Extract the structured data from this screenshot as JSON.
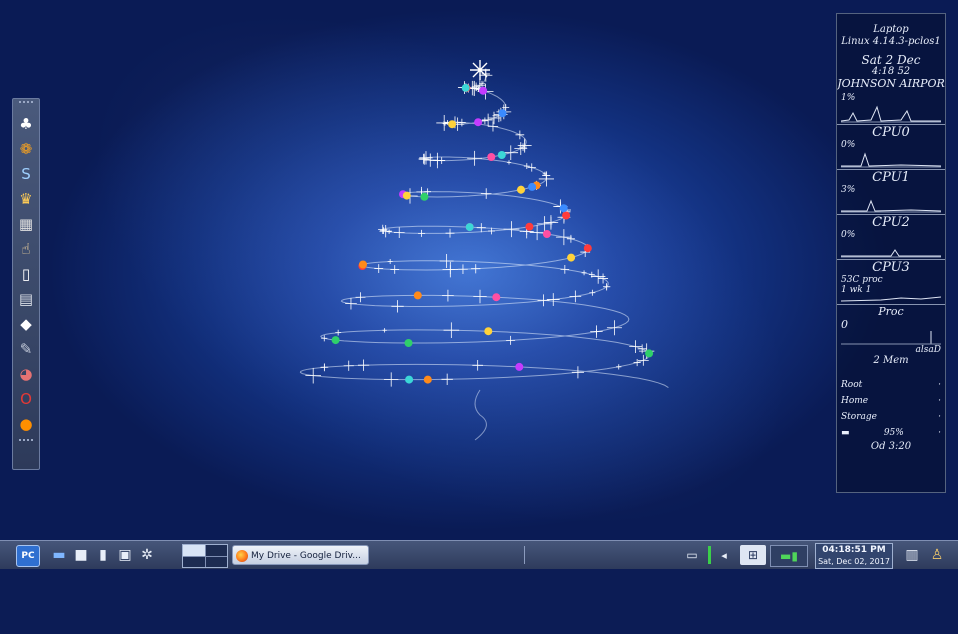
{
  "dock": {
    "items": [
      {
        "name": "clubs-icon",
        "glyph": "♣"
      },
      {
        "name": "bomb-app-icon",
        "glyph": "❁"
      },
      {
        "name": "skype-icon",
        "glyph": "S"
      },
      {
        "name": "jester-icon",
        "glyph": "♛"
      },
      {
        "name": "calendar-icon",
        "glyph": "▦"
      },
      {
        "name": "hand-icon",
        "glyph": "☝"
      },
      {
        "name": "document-icon",
        "glyph": "▯"
      },
      {
        "name": "clipboard-icon",
        "glyph": "▤"
      },
      {
        "name": "inkscape-icon",
        "glyph": "◆"
      },
      {
        "name": "paintbrush-icon",
        "glyph": "✎"
      },
      {
        "name": "gimp-icon",
        "glyph": "◕"
      },
      {
        "name": "opera-icon",
        "glyph": "O"
      },
      {
        "name": "firefox-icon",
        "glyph": "●"
      }
    ]
  },
  "conky": {
    "host": "Laptop",
    "kernel": "Linux 4.14.3-pclos1",
    "date": "Sat 2 Dec",
    "time": "4:18 52",
    "location": "JOHNSON AIRPOR",
    "cpu_total": "1%",
    "cpus": [
      {
        "label": "CPU0",
        "value": "0%"
      },
      {
        "label": "CPU1",
        "value": "3%"
      },
      {
        "label": "CPU2",
        "value": "0%"
      },
      {
        "label": "CPU3",
        "value": "53C proc"
      }
    ],
    "load": "1 wk 1",
    "proc_title": "Proc",
    "proc_value": "0",
    "proc_right": "alsaD",
    "mem_title": "Mem",
    "mem_pre": "2",
    "disks": [
      "Root",
      "Home",
      "Storage"
    ],
    "battery": "95%",
    "uptime": "Od 3:20"
  },
  "taskbar": {
    "kmenu_label": "PC",
    "quicklaunch": [
      {
        "name": "folder-icon",
        "glyph": "▬"
      },
      {
        "name": "terminal-icon",
        "glyph": "■"
      },
      {
        "name": "file-icon",
        "glyph": "▮"
      },
      {
        "name": "window-icon",
        "glyph": "▣"
      },
      {
        "name": "package-icon",
        "glyph": "✲"
      }
    ],
    "task_label": "My Drive - Google Driv...",
    "clock_time": "04:18:51 PM",
    "clock_date": "Sat, Dec 02, 2017"
  }
}
